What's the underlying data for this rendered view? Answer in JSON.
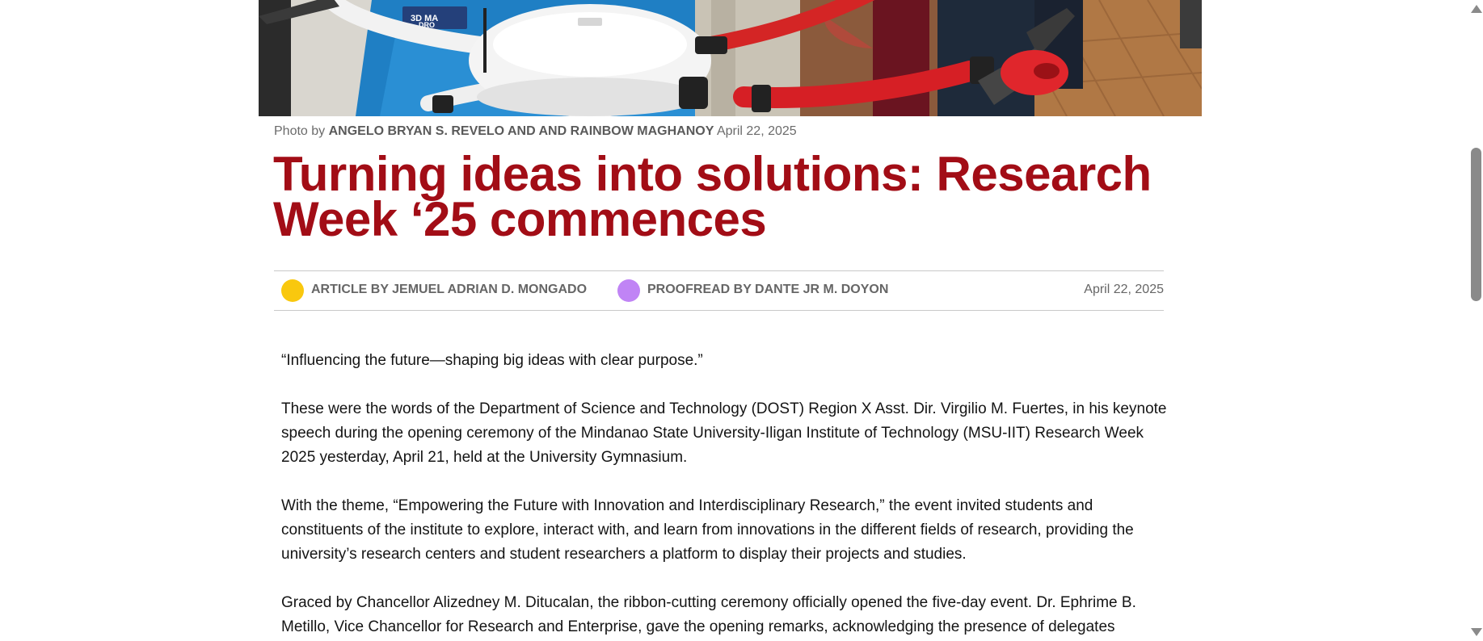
{
  "hero_image": {
    "sign_text": "3D MA\nDRO"
  },
  "caption": {
    "prefix": "Photo by",
    "credit": "ANGELO BRYAN S. REVELO AND AND RAINBOW MAGHANOY",
    "date": "April 22, 2025"
  },
  "article": {
    "title": "Turning ideas into solutions: Research Week ‘25 commences",
    "byline": {
      "author": "ARTICLE BY JEMUEL ADRIAN D. MONGADO",
      "proofreader": "PROOFREAD BY DANTE JR M. DOYON",
      "date": "April 22, 2025"
    },
    "paragraphs": [
      "“Influencing the future—shaping big ideas with clear purpose.”",
      "These were the words of the Department of Science and Technology (DOST) Region X Asst. Dir. Virgilio M. Fuertes, in his keynote speech during the opening ceremony of the Mindanao State University-Iligan Institute of Technology (MSU-IIT) Research Week 2025 yesterday, April 21, held at the University Gymnasium.",
      "With the theme, “Empowering the Future with Innovation and Interdisciplinary Research,” the event invited students and constituents of the institute to explore, interact with, and learn from innovations in the different fields of research, providing the university’s research centers and student researchers a platform to display their projects and studies.",
      "Graced by Chancellor Alizedney M. Ditucalan, the ribbon-cutting ceremony officially opened the five-day event. Dr. Ephrime B. Metillo, Vice Chancellor for Research and Enterprise, gave the opening remarks, acknowledging the presence of delegates"
    ]
  },
  "colors": {
    "title": "#a20d16",
    "author_dot": "#f9c80e",
    "proofreader_dot": "#c084f5"
  },
  "scrollbar": {
    "up_icon": "triangle-up-icon",
    "down_icon": "triangle-down-icon"
  }
}
